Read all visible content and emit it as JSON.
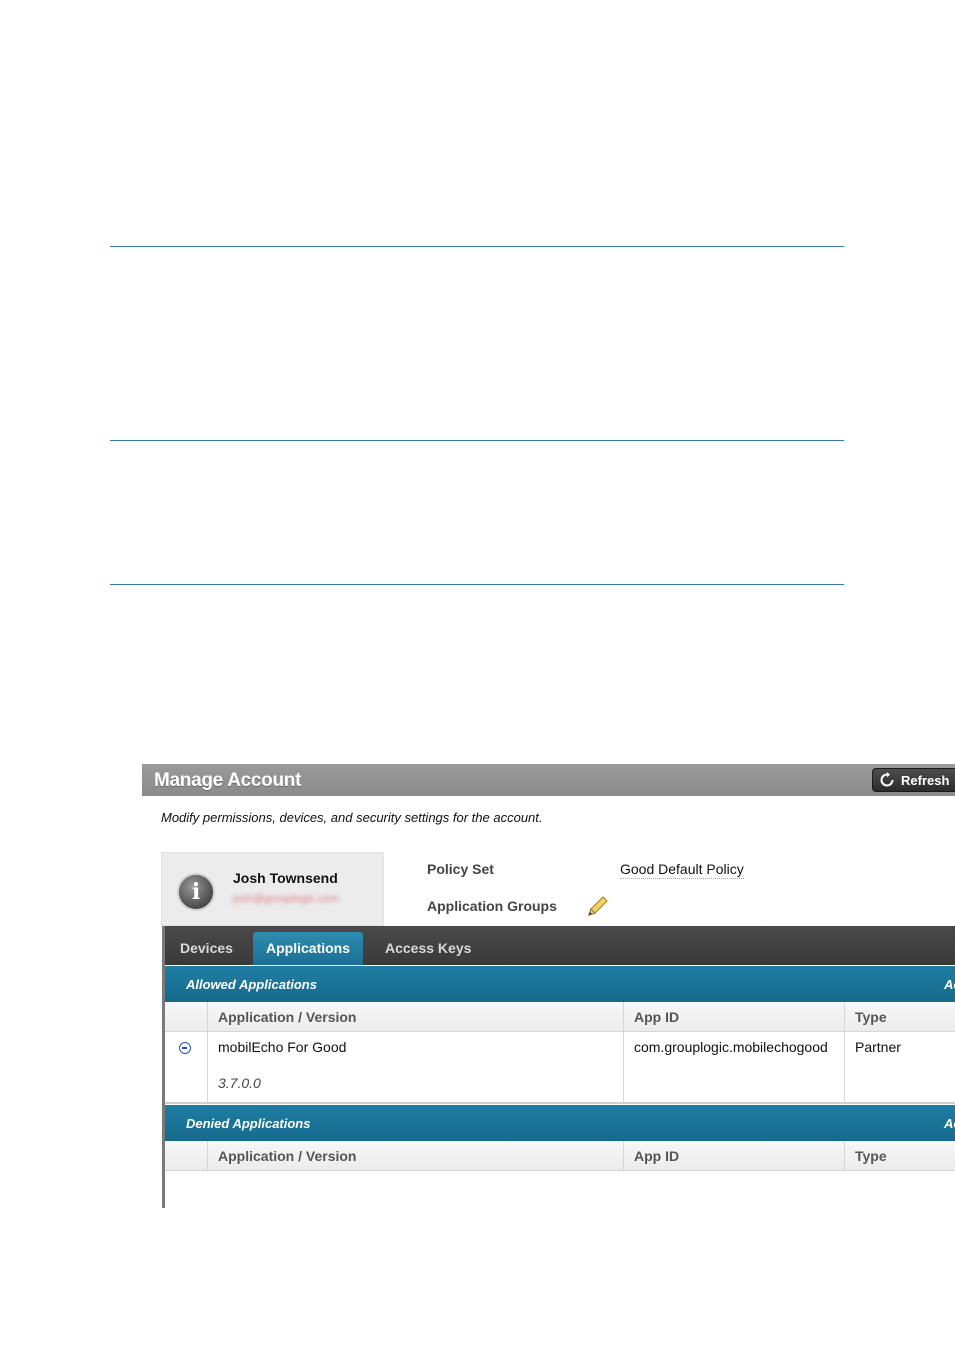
{
  "window": {
    "title": "Manage Account",
    "refresh_label": "Refresh"
  },
  "subtitle": "Modify permissions, devices, and security settings for the account.",
  "user": {
    "name": "Josh Townsend",
    "email": "josh@grouplogic.com"
  },
  "policy": {
    "policy_set_label": "Policy Set",
    "policy_set_value": "Good Default Policy",
    "app_groups_label": "Application Groups"
  },
  "tabs": [
    {
      "label": "Devices",
      "active": false
    },
    {
      "label": "Applications",
      "active": true
    },
    {
      "label": "Access Keys",
      "active": false
    }
  ],
  "allowed": {
    "title": "Allowed Applications",
    "action": "Ac",
    "columns": [
      "Application / Version",
      "App ID",
      "Type"
    ],
    "rows": [
      {
        "name": "mobilEcho For Good",
        "version": "3.7.0.0",
        "app_id": "com.grouplogic.mobilechogood",
        "type": "Partner"
      }
    ]
  },
  "denied": {
    "title": "Denied Applications",
    "action": "Ac",
    "columns": [
      "Application / Version",
      "App ID",
      "Type"
    ],
    "rows": []
  },
  "colors": {
    "section_blue": "#1f7ea3",
    "tab_active": "#2d8db0",
    "rule_blue": "#3a78b0"
  }
}
